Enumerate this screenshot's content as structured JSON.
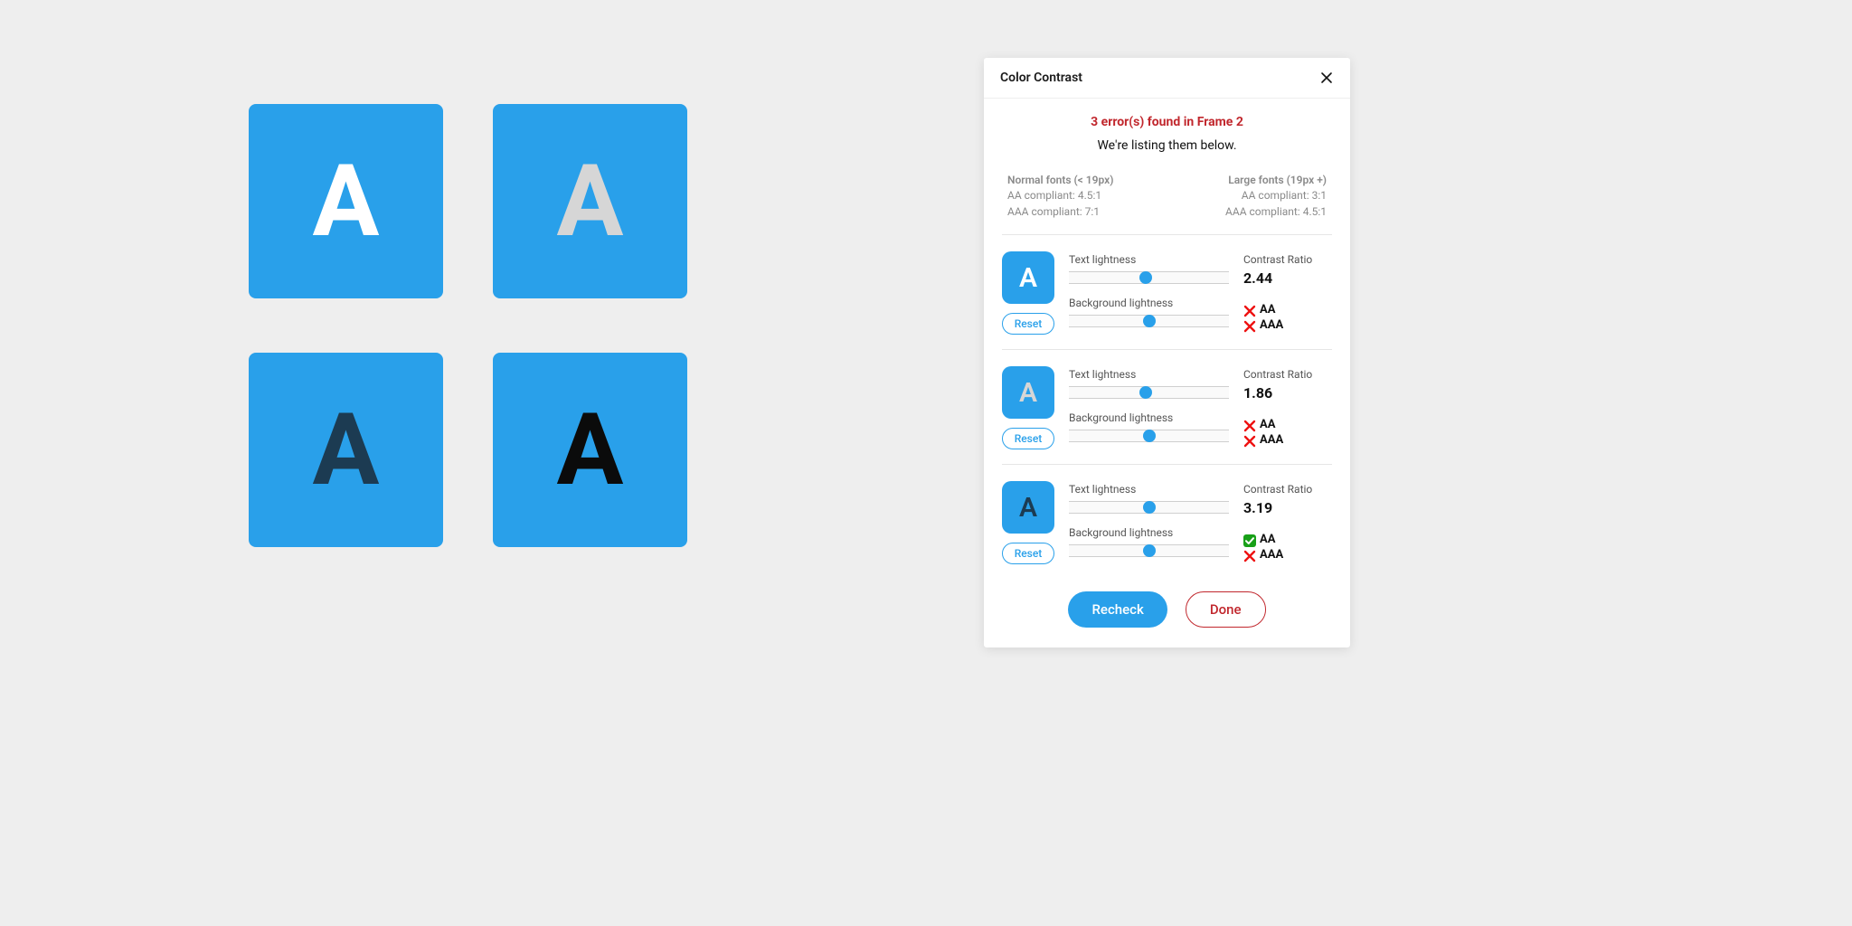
{
  "canvas": {
    "swatches": [
      {
        "bg": "#29a0ea",
        "fg": "#ffffff",
        "letter": "A"
      },
      {
        "bg": "#29a0ea",
        "fg": "#d6d6d6",
        "letter": "A"
      },
      {
        "bg": "#29a0ea",
        "fg": "#1c3b52",
        "letter": "A"
      },
      {
        "bg": "#29a0ea",
        "fg": "#0b0b0b",
        "letter": "A"
      }
    ]
  },
  "panel": {
    "title": "Color Contrast",
    "summary": {
      "error_line": "3 error(s) found in Frame 2",
      "sub_line": "We're listing them below."
    },
    "compliance": {
      "normal": {
        "heading": "Normal fonts (< 19px)",
        "aa": "AA compliant: 4.5:1",
        "aaa": "AAA compliant: 7:1"
      },
      "large": {
        "heading": "Large fonts (19px +)",
        "aa": "AA compliant: 3:1",
        "aaa": "AAA compliant: 4.5:1"
      }
    },
    "labels": {
      "text_lightness": "Text lightness",
      "background_lightness": "Background lightness",
      "contrast_ratio": "Contrast Ratio",
      "reset": "Reset",
      "aa": "AA",
      "aaa": "AAA"
    },
    "errors": [
      {
        "preview_bg": "#29a0ea",
        "preview_fg": "#ffffff",
        "letter": "A",
        "text_slider_pct": 48,
        "bg_slider_pct": 50,
        "ratio": "2.44",
        "aa_pass": false,
        "aaa_pass": false
      },
      {
        "preview_bg": "#29a0ea",
        "preview_fg": "#d6d6d6",
        "letter": "A",
        "text_slider_pct": 48,
        "bg_slider_pct": 50,
        "ratio": "1.86",
        "aa_pass": false,
        "aaa_pass": false
      },
      {
        "preview_bg": "#29a0ea",
        "preview_fg": "#1c3b52",
        "letter": "A",
        "text_slider_pct": 50,
        "bg_slider_pct": 50,
        "ratio": "3.19",
        "aa_pass": true,
        "aaa_pass": false
      }
    ],
    "footer": {
      "recheck": "Recheck",
      "done": "Done"
    }
  }
}
